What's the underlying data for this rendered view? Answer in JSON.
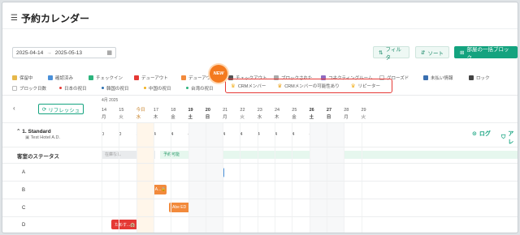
{
  "header": {
    "menu_icon": "menu-icon",
    "title": "予約カレンダー"
  },
  "toolbar": {
    "date_from": "2025-04-14",
    "date_sep": "→",
    "date_to": "2025-05-13",
    "filter_label": "フィルタ",
    "sort_label": "ソート",
    "block_label": "部屋の一括ブロック"
  },
  "legend": {
    "row1": [
      {
        "label": "保留中",
        "color": "#e6b84a"
      },
      {
        "label": "確認済み",
        "color": "#4a90d9"
      },
      {
        "label": "チェックイン",
        "color": "#2db47d"
      },
      {
        "label": "デューアウト",
        "color": "#e53935"
      },
      {
        "label": "デューアウト",
        "color": "#f28a3c"
      },
      {
        "label": "チェックアウト",
        "color": "#555555"
      },
      {
        "label": "ブロックされた",
        "color": "#aaaaaa"
      },
      {
        "label": "コネクティングルーム",
        "color": "#8e6bc2"
      },
      {
        "label": "グローズド",
        "color": "#ffffff"
      },
      {
        "label": "未払い情報",
        "color": "#3a6fb0"
      },
      {
        "label": "ロック",
        "color": "#444444"
      }
    ],
    "row2": [
      {
        "label": "ブロック日数",
        "color": "#ffffff"
      },
      {
        "label": "日本の祝日",
        "color": "#e53935"
      },
      {
        "label": "韓国の祝日",
        "color": "#2a6fb0"
      },
      {
        "label": "中国の祝日",
        "color": "#f2b01e"
      },
      {
        "label": "台湾の祝日",
        "color": "#2db47d"
      }
    ],
    "crm": [
      {
        "label": "CRMメンバー",
        "icon": "crown-icon"
      },
      {
        "label": "CRMメンバーの可能性あり",
        "icon": "warning-crown-icon"
      },
      {
        "label": "リピーター",
        "icon": "repeat-crown-icon"
      }
    ],
    "new_badge": "NEW"
  },
  "calendar": {
    "refresh_label": "リフレッシュ",
    "month_label": "4月 2025",
    "days": [
      {
        "num": "14",
        "dow": "月"
      },
      {
        "num": "15",
        "dow": "火"
      },
      {
        "num": "今日",
        "dow": "水"
      },
      {
        "num": "17",
        "dow": "木"
      },
      {
        "num": "18",
        "dow": "金"
      },
      {
        "num": "19",
        "dow": "土"
      },
      {
        "num": "20",
        "dow": "日"
      },
      {
        "num": "21",
        "dow": "月"
      },
      {
        "num": "22",
        "dow": "火"
      },
      {
        "num": "23",
        "dow": "水"
      },
      {
        "num": "24",
        "dow": "木"
      },
      {
        "num": "25",
        "dow": "金"
      },
      {
        "num": "26",
        "dow": "土"
      },
      {
        "num": "27",
        "dow": "日"
      },
      {
        "num": "28",
        "dow": "月"
      },
      {
        "num": "29",
        "dow": "火"
      }
    ],
    "room_type": "1. Standard",
    "hotel": "Test Hotel A.D.",
    "counts": [
      "0",
      "0",
      "3",
      "4",
      "4",
      "4",
      "4",
      "4",
      "4",
      "4",
      "4",
      "4",
      "4"
    ],
    "log_label": "ログ",
    "alert_label": "アレ",
    "status_label": "客室のステータス",
    "status_none": "在庫なし",
    "status_avail": "予約可能",
    "rooms": [
      "A",
      "B",
      "C",
      "D"
    ],
    "bookings": [
      {
        "label": "エアホ...🏨",
        "color": "#4a90d9"
      },
      {
        "label": "TEST A...🔒",
        "color": "#f28a3c"
      },
      {
        "label": "Abe ED 🔒",
        "color": "#f28a3c"
      },
      {
        "label": "ためす...🏨",
        "color": "#e53935"
      }
    ]
  }
}
